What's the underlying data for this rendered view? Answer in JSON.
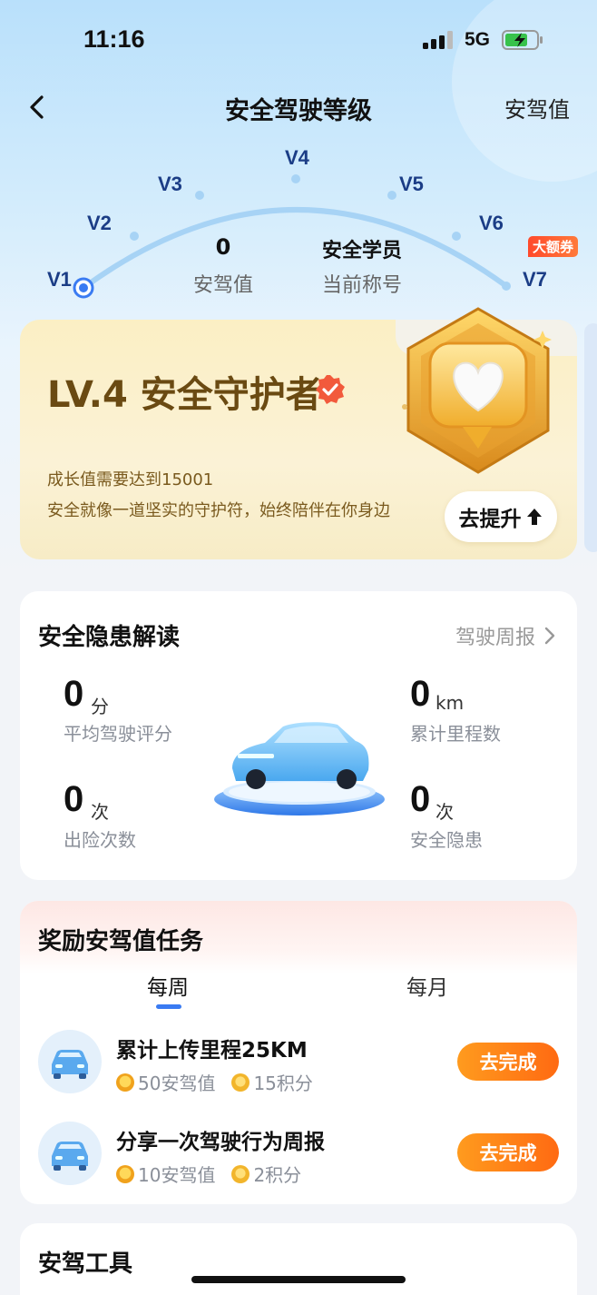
{
  "status_bar": {
    "time": "11:16",
    "network": "5G"
  },
  "nav": {
    "title": "安全驾驶等级",
    "right_link": "安驾值"
  },
  "gauge": {
    "levels": [
      "V1",
      "V2",
      "V3",
      "V4",
      "V5",
      "V6",
      "V7"
    ],
    "current_level_marker": "V1",
    "v7_tag": "大额券",
    "score_value": "0",
    "score_label": "安驾值",
    "title_value": "安全学员",
    "title_label": "当前称号"
  },
  "level_card": {
    "title": "LV.4 安全守护者",
    "growth_text": "成长值需要达到15001",
    "description": "安全就像一道坚实的守护符，始终陪伴在你身边",
    "upgrade_button": "去提升"
  },
  "risk_card": {
    "title": "安全隐患解读",
    "link": "驾驶周报",
    "stats": [
      {
        "value": "0",
        "unit": "分",
        "label": "平均驾驶评分"
      },
      {
        "value": "0",
        "unit": "km",
        "label": "累计里程数"
      },
      {
        "value": "0",
        "unit": "次",
        "label": "出险次数"
      },
      {
        "value": "0",
        "unit": "次",
        "label": "安全隐患"
      }
    ]
  },
  "tasks_card": {
    "title": "奖励安驾值任务",
    "tabs": [
      "每周",
      "每月"
    ],
    "active_tab": "每周",
    "tasks": [
      {
        "title": "累计上传里程25KM",
        "reward_points": "50安驾值",
        "reward_credits": "15积分",
        "button": "去完成"
      },
      {
        "title": "分享一次驾驶行为周报",
        "reward_points": "10安驾值",
        "reward_credits": "2积分",
        "button": "去完成"
      }
    ]
  },
  "tools_card": {
    "title": "安驾工具"
  },
  "colors": {
    "accent_blue": "#3a7bf2",
    "level_text": "#1b3d86",
    "orange_button": "#ff7a16",
    "gold_text": "#6a4a12"
  }
}
